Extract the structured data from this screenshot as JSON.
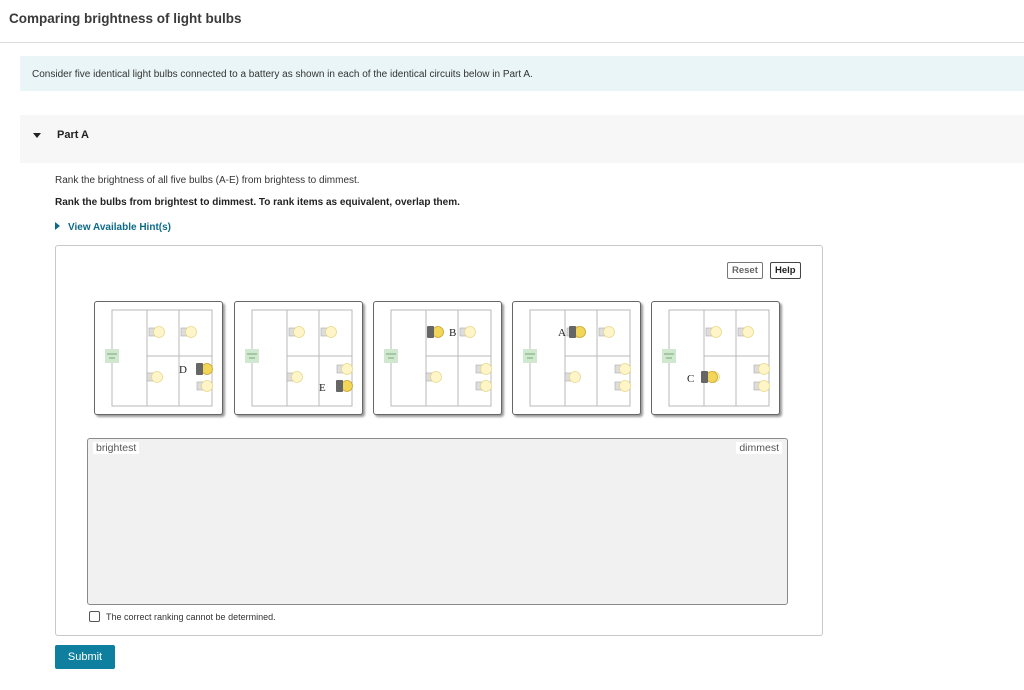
{
  "page": {
    "title": "Comparing brightness of light bulbs",
    "intro": "Consider five identical light bulbs connected to a battery as shown in each of the identical circuits below in Part A."
  },
  "part": {
    "label": "Part A",
    "question": "Rank the brightness of all five bulbs (A-E) from brightess to dimmest.",
    "instruction": "Rank the bulbs from brightest to dimmest. To rank items as equivalent, overlap them.",
    "hint_link": "View Available Hint(s)"
  },
  "ranking": {
    "reset_label": "Reset",
    "help_label": "Help",
    "tiles": [
      {
        "bulb": "D"
      },
      {
        "bulb": "E"
      },
      {
        "bulb": "B"
      },
      {
        "bulb": "A"
      },
      {
        "bulb": "C"
      }
    ],
    "left_label": "brightest",
    "right_label": "dimmest",
    "cannot_determine_label": "The correct ranking cannot be determined.",
    "cannot_determine_checked": false
  },
  "submit_label": "Submit",
  "colors": {
    "accent": "#0f7fa0",
    "hint_link": "#0d6a8a",
    "intro_bg": "#e9f5f6",
    "bulb_glow": "#f2d65a"
  }
}
